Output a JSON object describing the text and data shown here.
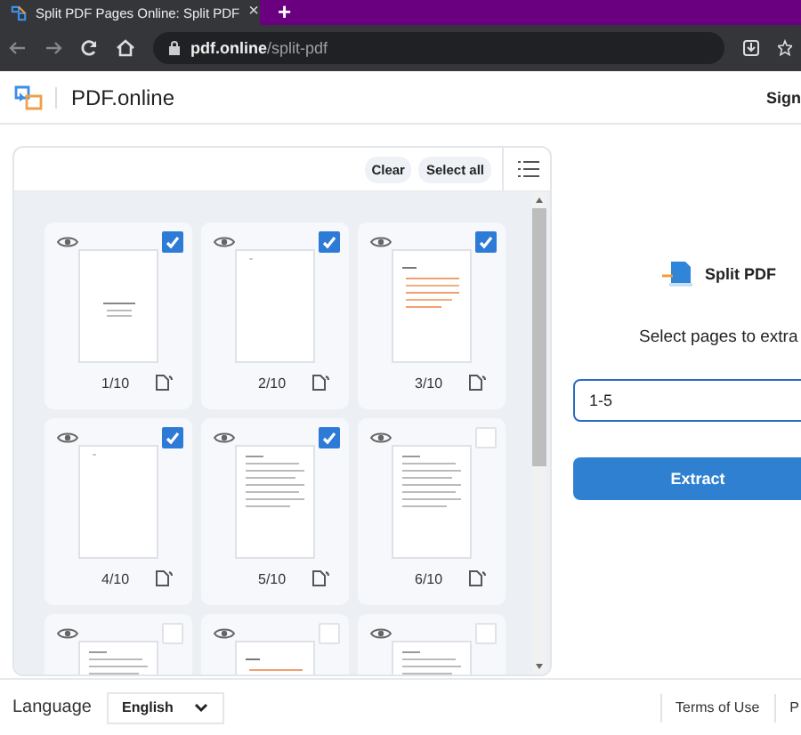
{
  "browser": {
    "tab_title": "Split PDF Pages Online: Split PDF",
    "tab_close": "×",
    "new_tab": "+",
    "url_host": "pdf.online",
    "url_path": "/split-pdf"
  },
  "header": {
    "brand": "PDF.online",
    "sign": "Sign"
  },
  "toolbar": {
    "buttons": [
      "Clear",
      "Select all"
    ]
  },
  "pages": [
    {
      "label": "1/10",
      "checked": true,
      "kind": "title"
    },
    {
      "label": "2/10",
      "checked": true,
      "kind": "blank"
    },
    {
      "label": "3/10",
      "checked": true,
      "kind": "table"
    },
    {
      "label": "4/10",
      "checked": true,
      "kind": "blank"
    },
    {
      "label": "5/10",
      "checked": true,
      "kind": "text"
    },
    {
      "label": "6/10",
      "checked": false,
      "kind": "text"
    },
    {
      "checked": false,
      "kind": "text"
    },
    {
      "checked": false,
      "kind": "table"
    },
    {
      "checked": false,
      "kind": "text"
    }
  ],
  "tool": {
    "title": "Split PDF",
    "prompt": "Select pages to extra",
    "range_value": "1-5",
    "button": "Extract"
  },
  "footer": {
    "language_label": "Language",
    "language": "English",
    "links": [
      "Terms of Use",
      "P"
    ]
  }
}
